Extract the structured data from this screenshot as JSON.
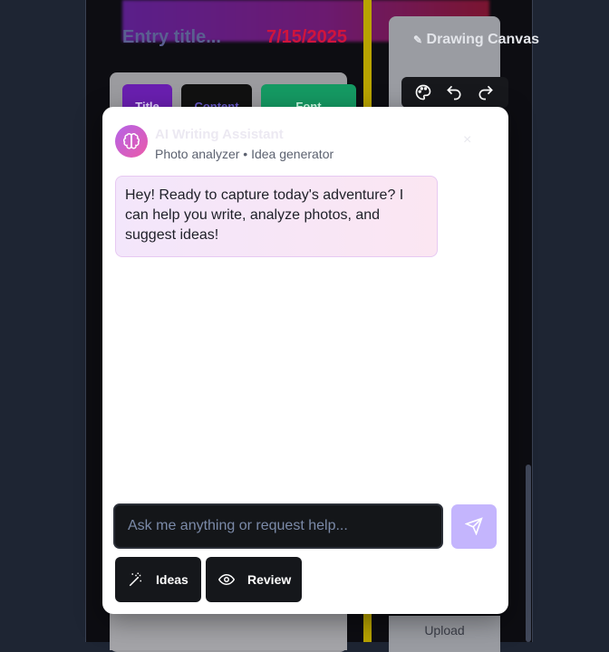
{
  "background": {
    "entry_title_placeholder": "Entry title...",
    "entry_date": "7/15/2025",
    "toolbar": {
      "title": "Title",
      "content": "Content",
      "font": "Font"
    },
    "drawing_canvas": "Drawing Canvas",
    "upload": "Upload"
  },
  "assistant": {
    "name": "AI Writing Assistant",
    "subtitle": "Photo analyzer • Idea generator",
    "close": "×",
    "greeting": "Hey! Ready to capture today's adventure? I can help you write, analyze photos, and suggest ideas!",
    "input_placeholder": "Ask me anything or request help...",
    "actions": {
      "ideas": "Ideas",
      "review": "Review"
    }
  },
  "colors": {
    "accent": "#c4b5fd",
    "avatar_start": "#b363e8",
    "avatar_end": "#ec5aa8",
    "date": "#d0143c"
  },
  "icons": [
    "brain-icon",
    "send-icon",
    "magic-wand-icon",
    "eye-icon",
    "palette-icon",
    "undo-icon",
    "redo-icon",
    "pencil-icon"
  ]
}
